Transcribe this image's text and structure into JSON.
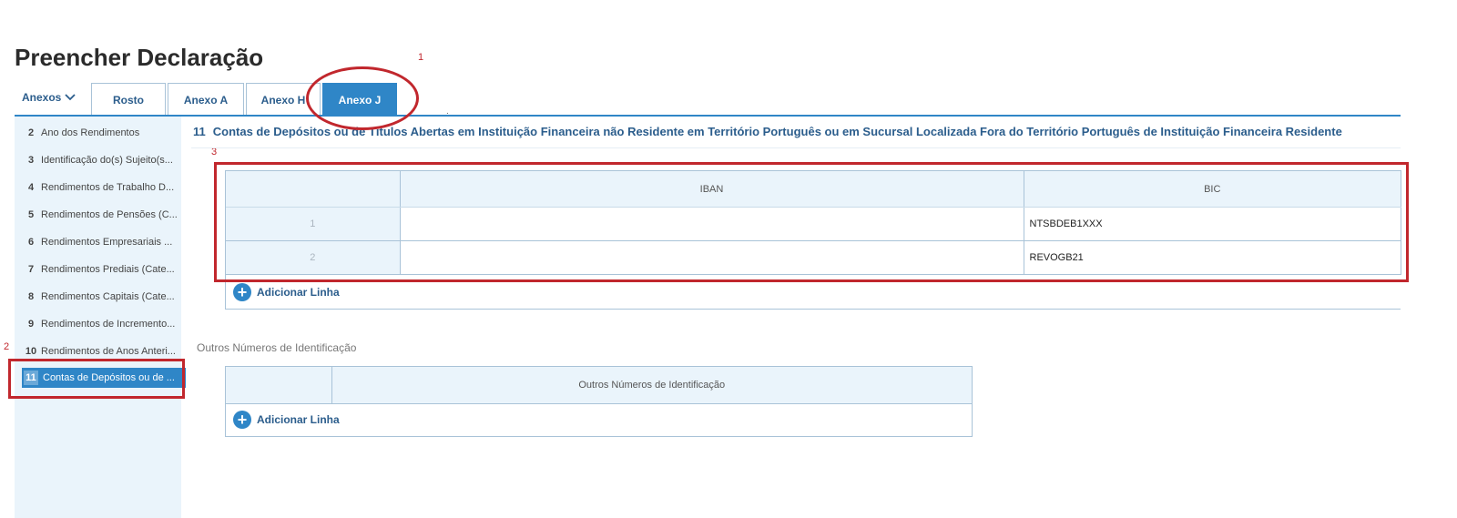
{
  "page_title": "Preencher Declaração",
  "annotations": {
    "one": "1",
    "two": "2",
    "three": "3"
  },
  "tabs_bar": {
    "anexos_label": "Anexos",
    "tabs": [
      {
        "label": "Rosto"
      },
      {
        "label": "Anexo A"
      },
      {
        "label": "Anexo H"
      },
      {
        "label": "Anexo J"
      }
    ],
    "active_tab": "Anexo J",
    "tiny_mark": "."
  },
  "sidebar": {
    "items": [
      {
        "num": "2",
        "label": "Ano dos Rendimentos"
      },
      {
        "num": "3",
        "label": "Identificação do(s) Sujeito(s..."
      },
      {
        "num": "4",
        "label": "Rendimentos de Trabalho D..."
      },
      {
        "num": "5",
        "label": "Rendimentos de Pensões (C..."
      },
      {
        "num": "6",
        "label": "Rendimentos Empresariais ..."
      },
      {
        "num": "7",
        "label": "Rendimentos Prediais (Cate..."
      },
      {
        "num": "8",
        "label": "Rendimentos Capitais (Cate..."
      },
      {
        "num": "9",
        "label": "Rendimentos de Incremento..."
      },
      {
        "num": "10",
        "label": "Rendimentos de Anos Anteri..."
      },
      {
        "num": "11",
        "label": "Contas de Depósitos ou de ..."
      }
    ],
    "active_num": "11"
  },
  "section": {
    "num": "11",
    "title": "Contas de Depósitos ou de Títulos Abertas em Instituição Financeira não Residente em Território Português ou em Sucursal Localizada Fora do Território Português de Instituição Financeira Residente"
  },
  "accounts_table": {
    "headers": [
      "",
      "IBAN",
      "BIC"
    ],
    "rows": [
      {
        "num": "1",
        "iban": "",
        "bic": "NTSBDEB1XXX"
      },
      {
        "num": "2",
        "iban": "",
        "bic": "REVOGB21"
      }
    ],
    "add_line_label": "Adicionar Linha"
  },
  "outros": {
    "label": "Outros Números de Identificação",
    "headers": [
      "",
      "Outros Números de Identificação"
    ],
    "add_line_label": "Adicionar Linha"
  },
  "colors": {
    "accent": "#2f86c7",
    "heading": "#2b5d8c",
    "annotation_red": "#c1272d",
    "sidebar_bg": "#eaf4fb"
  }
}
